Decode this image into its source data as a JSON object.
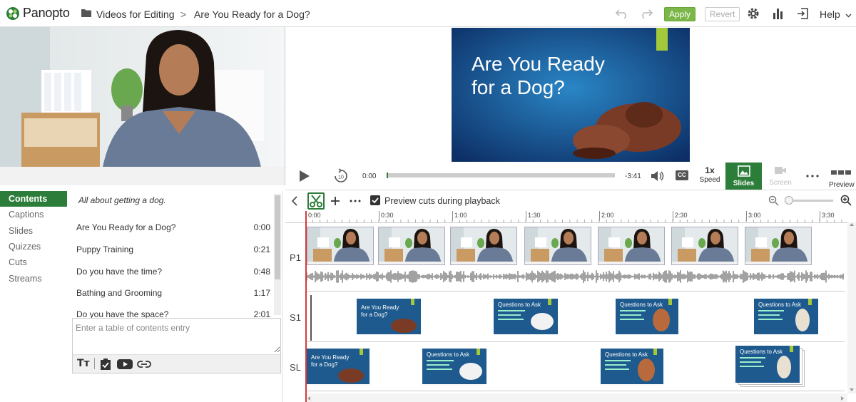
{
  "header": {
    "logo": "Panopto",
    "breadcrumb_folder": "Videos for Editing",
    "breadcrumb_separator": ">",
    "breadcrumb_session": "Are You Ready for a Dog?",
    "apply_label": "Apply",
    "revert_label": "Revert",
    "help_label": "Help"
  },
  "slide": {
    "title_line1": "Are You Ready",
    "title_line2": "for a Dog?"
  },
  "player": {
    "current_time": "0:00",
    "remaining_time": "-3:41",
    "cc_label": "CC",
    "speed_value": "1x",
    "speed_label": "Speed",
    "slides_label": "Slides",
    "screen_label": "Screen",
    "preview_label": "Preview",
    "progress": 0
  },
  "tabs": [
    "Contents",
    "Captions",
    "Slides",
    "Quizzes",
    "Cuts",
    "Streams"
  ],
  "contents": {
    "description": "All about getting a dog.",
    "entries": [
      {
        "title": "Are You Ready for a Dog?",
        "time": "0:00"
      },
      {
        "title": "Puppy Training",
        "time": "0:21"
      },
      {
        "title": "Do you have the time?",
        "time": "0:48"
      },
      {
        "title": "Bathing and Grooming",
        "time": "1:17"
      },
      {
        "title": "Do you have the space?",
        "time": "2:01"
      }
    ],
    "input_placeholder": "Enter a table of contents entry"
  },
  "editor": {
    "preview_cuts_label": "Preview cuts during playback",
    "preview_cuts_checked": true,
    "ruler_ticks": [
      "0:00",
      "0:30",
      "1:00",
      "1:30",
      "2:00",
      "2:30",
      "3:00",
      "3:30"
    ],
    "tracks": [
      "P1",
      "S1",
      "SL"
    ],
    "slide_thumb_titles": [
      "Are You Ready for a Dog?",
      "Questions to Ask",
      "Questions to Ask",
      "Questions to Ask"
    ]
  },
  "colors": {
    "accent": "#2d7d3a",
    "apply": "#7ab648",
    "playhead": "#d43a3a",
    "slide_bg": "#1e5a8e"
  }
}
